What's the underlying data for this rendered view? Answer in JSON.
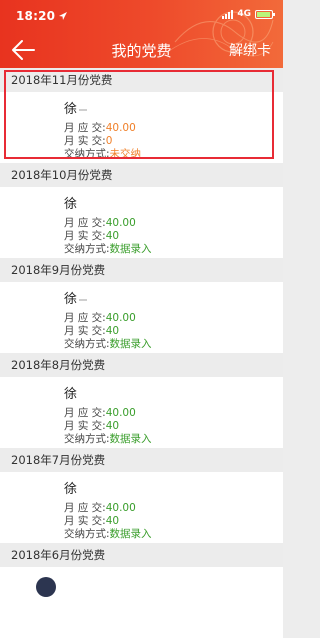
{
  "status_bar": {
    "time": "18:20",
    "network": "4G"
  },
  "nav": {
    "title": "我的党费",
    "action_label": "解绑卡"
  },
  "field_labels": {
    "due": "月 应 交:",
    "paid": "月 实 交:",
    "method": "交纳方式:"
  },
  "records": [
    {
      "month": "2018年11月份党费",
      "name": "徐",
      "due": "40.00",
      "paid": "0",
      "method": "未交纳",
      "status": "unpaid"
    },
    {
      "month": "2018年10月份党费",
      "name": "徐",
      "due": "40.00",
      "paid": "40",
      "method": "数据录入",
      "status": "paid"
    },
    {
      "month": "2018年9月份党费",
      "name": "徐",
      "due": "40.00",
      "paid": "40",
      "method": "数据录入",
      "status": "paid"
    },
    {
      "month": "2018年8月份党费",
      "name": "徐",
      "due": "40.00",
      "paid": "40",
      "method": "数据录入",
      "status": "paid"
    },
    {
      "month": "2018年7月份党费",
      "name": "徐",
      "due": "40.00",
      "paid": "40",
      "method": "数据录入",
      "status": "paid"
    },
    {
      "month": "2018年6月份党费"
    }
  ],
  "colors": {
    "accent": "#ea3c24",
    "paid_value": "#3a9e2c",
    "unpaid_value": "#f0812b",
    "highlight": "#e82b35"
  },
  "icons": {
    "back": "back-arrow-icon",
    "signal": "signal-icon",
    "battery": "battery-icon"
  }
}
